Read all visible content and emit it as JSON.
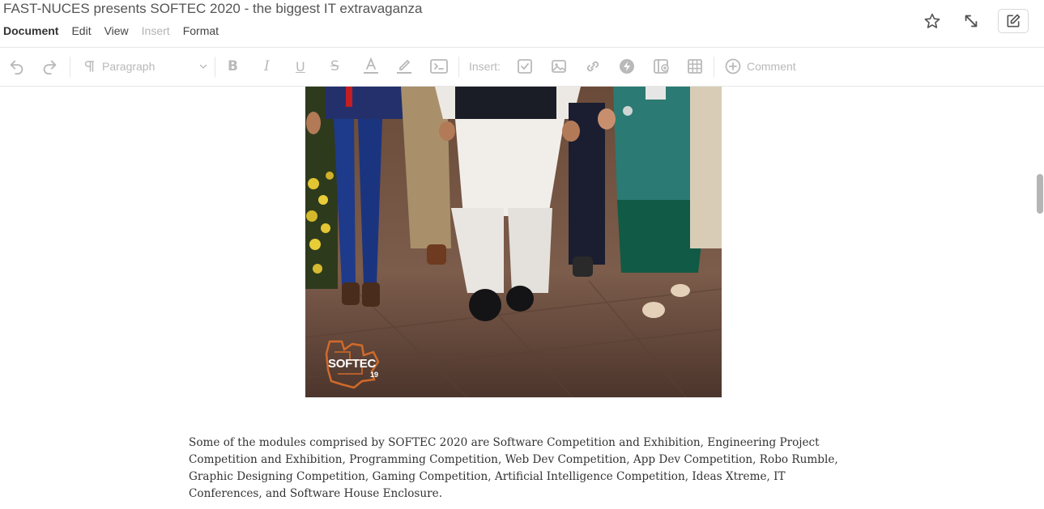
{
  "document": {
    "title": "FAST-NUCES presents SOFTEC 2020 - the biggest IT extravaganza"
  },
  "menu": {
    "items": [
      {
        "label": "Document",
        "state": "active"
      },
      {
        "label": "Edit",
        "state": "normal"
      },
      {
        "label": "View",
        "state": "normal"
      },
      {
        "label": "Insert",
        "state": "disabled"
      },
      {
        "label": "Format",
        "state": "normal"
      }
    ]
  },
  "top_actions": {
    "icons": [
      "star-icon",
      "resize-icon",
      "edit-icon"
    ]
  },
  "toolbar": {
    "paragraph_style": "Paragraph",
    "insert_label": "Insert:",
    "comment_label": "Comment",
    "icon_color": "#b9b9b9"
  },
  "content": {
    "image": {
      "logo_text": "SOFTEC",
      "logo_year": "19"
    },
    "paragraph": "Some of the modules comprised by SOFTEC 2020 are Software Competition and Exhibition, Engineering Project Competition and Exhibition, Programming Competition, Web Dev Competition, App Dev Competition, Robo Rumble, Graphic Designing Competition, Gaming Competition, Artificial Intelligence Competition, Ideas Xtreme, IT Conferences, and Software House Enclosure."
  }
}
